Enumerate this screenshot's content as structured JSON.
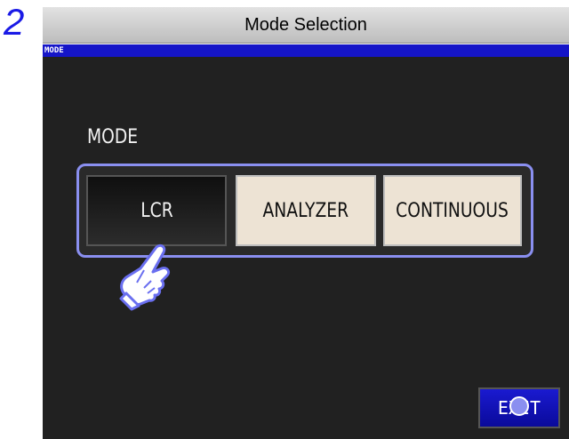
{
  "step": {
    "number": "2"
  },
  "banner": {
    "title": "Mode Selection"
  },
  "screen": {
    "title_bar": "MODE",
    "section_label": "MODE",
    "mode_buttons": [
      {
        "label": "LCR",
        "selected": true
      },
      {
        "label": "ANALYZER",
        "selected": false
      },
      {
        "label": "CONTINUOUS",
        "selected": false
      }
    ],
    "exit_label": "EXIT"
  },
  "colors": {
    "title_bar": "#1515c8",
    "highlight": "#8a8ff0",
    "button_face": "#ede3d4",
    "screen_bg": "#212121",
    "step_number": "#1a1ae6"
  },
  "icons": [
    "pointing-hand-icon",
    "touch-indicator-icon"
  ]
}
